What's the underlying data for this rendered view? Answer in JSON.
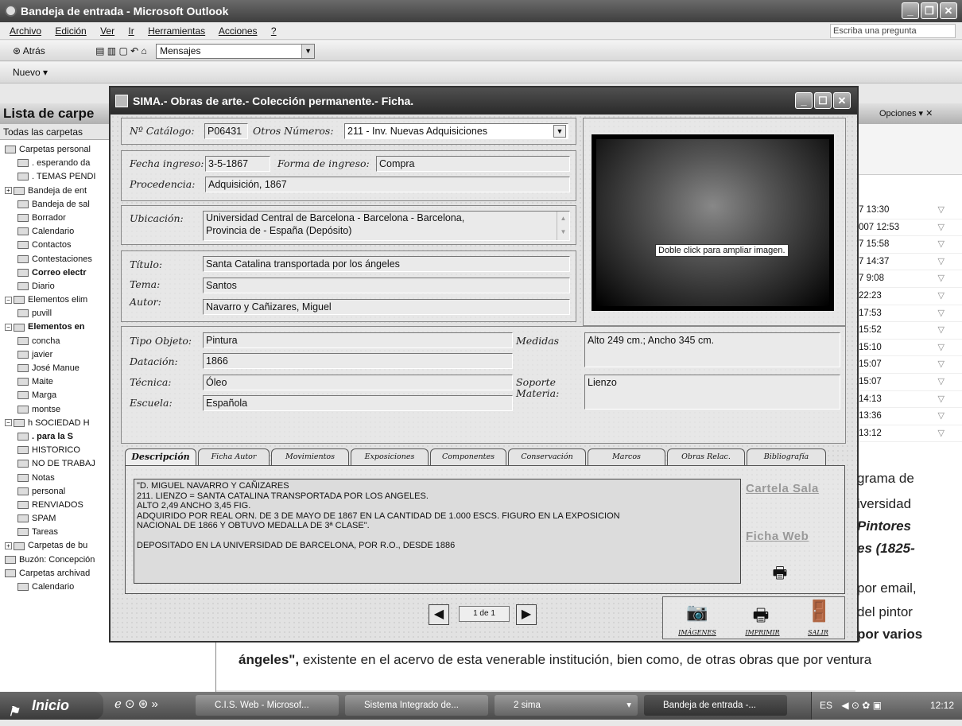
{
  "outlook": {
    "title": "Bandeja de entrada - Microsoft Outlook",
    "menu": [
      "Archivo",
      "Edición",
      "Ver",
      "Ir",
      "Herramientas",
      "Acciones",
      "?"
    ],
    "ask_placeholder": "Escriba una pregunta",
    "toolbar": {
      "back": "Atrás",
      "view_combo": "Mensajes",
      "new": "Nuevo"
    },
    "nav": {
      "title": "Lista de carpe",
      "subtitle": "Todas las carpetas",
      "folders": [
        "Carpetas personal",
        ". esperando da",
        ". TEMAS PENDI",
        "Bandeja de ent",
        "Bandeja de sal",
        "Borrador",
        "Calendario",
        "Contactos",
        "Contestaciones",
        "Correo electr",
        "Diario",
        "Elementos elim",
        "puvill",
        "Elementos en",
        "concha",
        "javier",
        "José Manue",
        "Maite",
        "Marga",
        "montse",
        "h SOCIEDAD H",
        ". para la S",
        "HISTORICO",
        "NO DE TRABAJ",
        "Notas",
        "personal",
        "RENVIADOS",
        "SPAM",
        "Tareas",
        "Carpetas de bu",
        "Buzón: Concepción",
        "Carpetas archivad",
        "Calendario"
      ]
    },
    "options_label": "Opciones",
    "mail_times": [
      "7 13:30",
      "007 12:53",
      "7 15:58",
      "7 14:37",
      "7 9:08",
      "22:23",
      "17:53",
      "15:52",
      "15:10",
      "15:07",
      "15:07",
      "14:13",
      "13:36",
      "13:12"
    ],
    "preview_right": [
      "grama de",
      "iversidad",
      "Pintores",
      "es (1825-",
      "por email,",
      "del pintor",
      "por varios"
    ],
    "preview_line_bold": "ángeles\",",
    "preview_line_rest": " existente en el acervo de esta venerable institución, bien como, de otras obras que por ventura"
  },
  "sima": {
    "title": "SIMA.- Obras de arte.- Colección permanente.- Ficha.",
    "labels": {
      "catalogo": "Nº Catálogo:",
      "otros": "Otros Números:",
      "fecha": "Fecha ingreso:",
      "forma": "Forma de ingreso:",
      "procedencia": "Procedencia:",
      "ubicacion": "Ubicación:",
      "titulo": "Título:",
      "tema": "Tema:",
      "autor": "Autor:",
      "tipo": "Tipo Objeto:",
      "datacion": "Datación:",
      "tecnica": "Técnica:",
      "escuela": "Escuela:",
      "medidas": "Medidas",
      "soporte1": "Soporte",
      "soporte2": "Materia:"
    },
    "values": {
      "catalogo": "P06431",
      "otros": "211 - Inv. Nuevas Adquisiciones",
      "fecha": "3-5-1867",
      "forma": "Compra",
      "procedencia": "Adquisición, 1867",
      "ubicacion1": "Universidad Central de Barcelona - Barcelona - Barcelona,",
      "ubicacion2": "Provincia de - España (Depósito)",
      "titulo": "Santa Catalina transportada por los ángeles",
      "tema": "Santos",
      "autor": "Navarro y Cañizares, Miguel",
      "tipo": "Pintura",
      "datacion": "1866",
      "tecnica": "Óleo",
      "escuela": "Española",
      "medidas": "Alto 249 cm.; Ancho 345 cm.",
      "soporte": "Lienzo"
    },
    "image_tooltip": "Doble click para ampliar imagen.",
    "tabs": [
      "Descripción",
      "Ficha Autor",
      "Movimientos",
      "Exposiciones",
      "Componentes",
      "Conservación",
      "Marcos",
      "Obras Relac.",
      "Bibliografía"
    ],
    "description": "\"D. MIGUEL NAVARRO Y CAÑIZARES\n211. LIENZO = SANTA CATALINA TRANSPORTADA POR LOS ANGELES.\nALTO 2,49 ANCHO 3,45 FIG.\nADQUIRIDO POR REAL ORN. DE 3 DE MAYO DE 1867 EN LA CANTIDAD DE 1.000 ESCS. FIGURO EN LA EXPOSICION\nNACIONAL DE 1866 Y OBTUVO MEDALLA DE 3ª CLASE\".\n\nDEPOSITADO EN LA UNIVERSIDAD DE BARCELONA, POR R.O., DESDE 1886",
    "links": {
      "cartela": "Cartela Sala",
      "ficha_web": "Ficha Web"
    },
    "pager": "1 de 1",
    "buttons": {
      "imagenes": "IMÁGENES",
      "imprimir": "IMPRIMIR",
      "salir": "SALIR"
    }
  },
  "taskbar": {
    "start": "Inicio",
    "items": [
      "C.I.S. Web - Microsof...",
      "Sistema Integrado de...",
      "2 sima",
      "Bandeja de entrada -..."
    ],
    "lang": "ES",
    "clock": "12:12"
  }
}
